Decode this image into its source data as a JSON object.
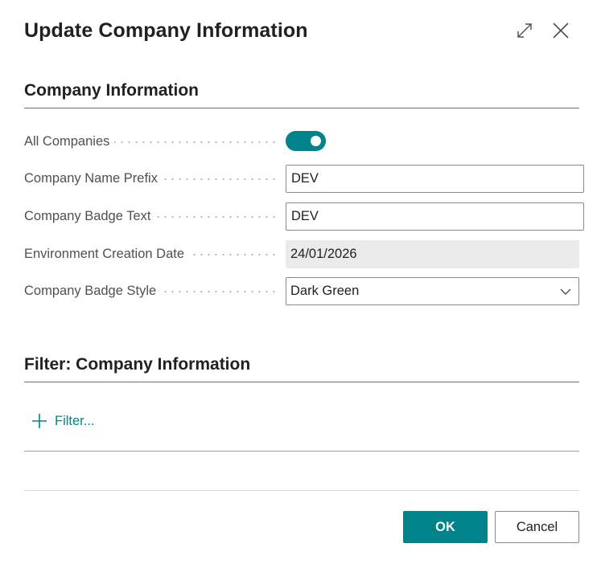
{
  "dialog": {
    "title": "Update Company Information"
  },
  "section_company": {
    "header": "Company Information",
    "fields": {
      "all_companies": {
        "label": "All Companies",
        "value": true
      },
      "name_prefix": {
        "label": "Company Name Prefix",
        "value": "DEV"
      },
      "badge_text": {
        "label": "Company Badge Text",
        "value": "DEV"
      },
      "creation_date": {
        "label": "Environment Creation Date",
        "value": "24/01/2026"
      },
      "badge_style": {
        "label": "Company Badge Style",
        "value": "Dark Green"
      }
    }
  },
  "section_filter": {
    "header": "Filter: Company Information",
    "add_filter_label": "Filter..."
  },
  "footer": {
    "ok_label": "OK",
    "cancel_label": "Cancel"
  },
  "icons": {
    "expand": "expand-icon",
    "close": "close-icon",
    "chevron": "chevron-down-icon",
    "plus": "plus-icon"
  },
  "colors": {
    "accent": "#00838a",
    "readonly_bg": "#ebebeb"
  }
}
